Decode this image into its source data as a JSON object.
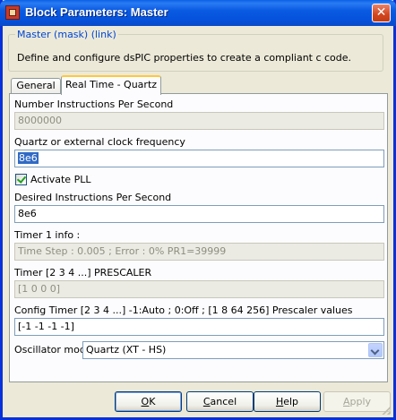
{
  "window": {
    "title": "Block Parameters: Master",
    "close_glyph": "✕",
    "icon": "simulink-block-icon"
  },
  "group": {
    "legend": "Master (mask) (link)",
    "description": "Define and configure dsPIC properties to create a compliant c code."
  },
  "tabs": [
    {
      "label": "General",
      "active": false
    },
    {
      "label": "Real Time - Quartz",
      "active": true
    }
  ],
  "fields": {
    "nips": {
      "label": "Number Instructions Per Second",
      "value": "8000000",
      "enabled": false
    },
    "quartz": {
      "label": "Quartz or external clock frequency",
      "value": "8e6",
      "enabled": true,
      "selected": true
    },
    "pll": {
      "label": "Activate PLL",
      "checked": true
    },
    "dips": {
      "label": "Desired Instructions Per Second",
      "value": "8e6",
      "enabled": true
    },
    "timer1": {
      "label": "Timer 1 info :",
      "value": "Time Step : 0.005  ;   Error : 0%  PR1=39999",
      "enabled": false
    },
    "prescaler": {
      "label": "Timer [2 3 4 ...]  PRESCALER",
      "value": "[1  0  0  0]",
      "enabled": false
    },
    "config_timer": {
      "label": "Config Timer [2 3 4 ...]   -1:Auto   ; 0:Off   ;   [1 8 64 256] Prescaler values",
      "value": "[-1 -1 -1 -1]",
      "enabled": true
    },
    "osc": {
      "label": "Oscillator mode",
      "value": "Quartz (XT - HS)"
    }
  },
  "buttons": {
    "ok": {
      "label": "OK",
      "mnemonic": "O",
      "rest": "K"
    },
    "cancel": {
      "label": "Cancel",
      "mnemonic": "C",
      "rest": "ancel"
    },
    "help": {
      "label": "Help",
      "mnemonic": "H",
      "rest": "elp"
    },
    "apply": {
      "label": "Apply",
      "mnemonic": "A",
      "rest": "pply",
      "enabled": false
    }
  },
  "colors": {
    "titlebar": "#0553dc",
    "window_bg": "#ece9d8",
    "legend_text": "#0046d5",
    "tab_accent": "#ffc83c",
    "selection": "#316ac5"
  }
}
